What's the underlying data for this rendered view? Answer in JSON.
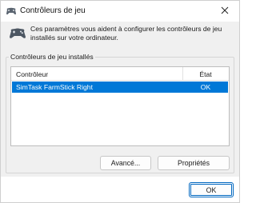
{
  "window": {
    "title": "Contrôleurs de jeu",
    "icon": "gamepad-icon",
    "close_icon": "close-icon"
  },
  "description": {
    "text": "Ces paramètres vous aident à configurer les contrôleurs de jeu installés sur votre ordinateur.",
    "icon": "gamepad-icon"
  },
  "group": {
    "label": "Contrôleurs de jeu installés"
  },
  "table": {
    "columns": [
      "Contrôleur",
      "État"
    ],
    "rows": [
      {
        "name": "SimTask FarmStick Right",
        "state": "OK",
        "selected": true
      }
    ]
  },
  "buttons": {
    "advanced": "Avancé...",
    "properties": "Propriétés",
    "ok": "OK"
  },
  "colors": {
    "selection": "#0078d7",
    "accent": "#0067c0",
    "panel": "#f0f0f0"
  }
}
